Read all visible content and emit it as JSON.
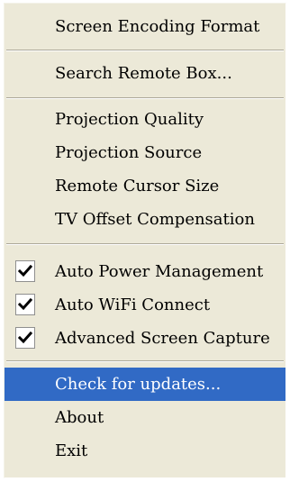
{
  "menu": {
    "items": [
      {
        "label": "Screen Encoding Format"
      },
      {
        "label": "Search Remote Box..."
      },
      {
        "label": "Projection Quality"
      },
      {
        "label": "Projection Source"
      },
      {
        "label": "Remote Cursor Size"
      },
      {
        "label": "TV Offset Compensation"
      },
      {
        "label": "Auto Power Management",
        "checked": true
      },
      {
        "label": "Auto WiFi Connect",
        "checked": true
      },
      {
        "label": "Advanced Screen Capture",
        "checked": true
      },
      {
        "label": "Check for updates...",
        "highlighted": true
      },
      {
        "label": "About"
      },
      {
        "label": "Exit"
      }
    ]
  },
  "colors": {
    "menu_background": "#ece9d8",
    "highlight": "#316ac5",
    "highlight_text": "#ffffff",
    "separator": "#aca899"
  },
  "icons": {
    "check": "check-icon"
  }
}
